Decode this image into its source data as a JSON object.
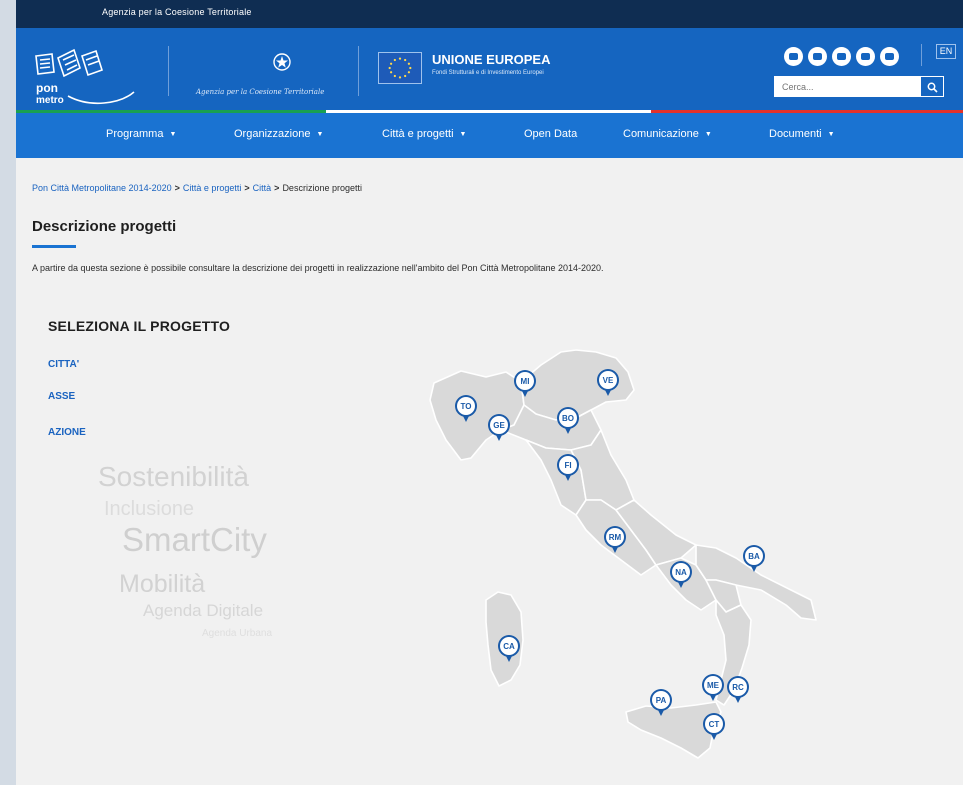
{
  "agency": "Agenzia per la Coesione Territoriale",
  "header": {
    "logo": "PON METRO",
    "gov_name": "Agenzia per la Coesione Territoriale",
    "eu_title": "UNIONE EUROPEA",
    "eu_subtitle": "Fondi Strutturali e di Investimento Europei",
    "social_icons": [
      "twitter-icon",
      "youtube-icon",
      "instagram-icon",
      "flickr-icon",
      "vimeo-icon"
    ],
    "lang": "EN",
    "search_placeholder": "Cerca..."
  },
  "nav": [
    {
      "label": "Programma",
      "dropdown": true
    },
    {
      "label": "Organizzazione",
      "dropdown": true
    },
    {
      "label": "Città e progetti",
      "dropdown": true
    },
    {
      "label": "Open Data",
      "dropdown": false
    },
    {
      "label": "Comunicazione",
      "dropdown": true
    },
    {
      "label": "Documenti",
      "dropdown": true
    }
  ],
  "breadcrumb": {
    "items": [
      "Pon Città Metropolitane 2014-2020",
      "Città e progetti",
      "Città"
    ],
    "current": "Descrizione progetti",
    "separator": ">"
  },
  "page_title": "Descrizione progetti",
  "intro": "A partire da questa sezione è possibile consultare la descrizione dei progetti in realizzazione nell'ambito del Pon Città Metropolitane 2014-2020.",
  "selector": {
    "title": "SELEZIONA IL PROGETTO",
    "filters": [
      "CITTA'",
      "ASSE",
      "AZIONE"
    ]
  },
  "tag_cloud": [
    "Sostenibilità",
    "Inclusione",
    "SmartCity",
    "Mobilità",
    "Agenda Digitale",
    "Agenda Urbana"
  ],
  "cities": [
    "MI",
    "VE",
    "TO",
    "GE",
    "BO",
    "FI",
    "RM",
    "NA",
    "BA",
    "CA",
    "PA",
    "ME",
    "RC",
    "CT"
  ],
  "colors": {
    "top_strip": "#0f2d52",
    "header": "#1565c0",
    "nav": "#1a73d2",
    "link": "#1a63c0",
    "pin": "#1a5aa8",
    "map_region": "#d9d9d9"
  }
}
